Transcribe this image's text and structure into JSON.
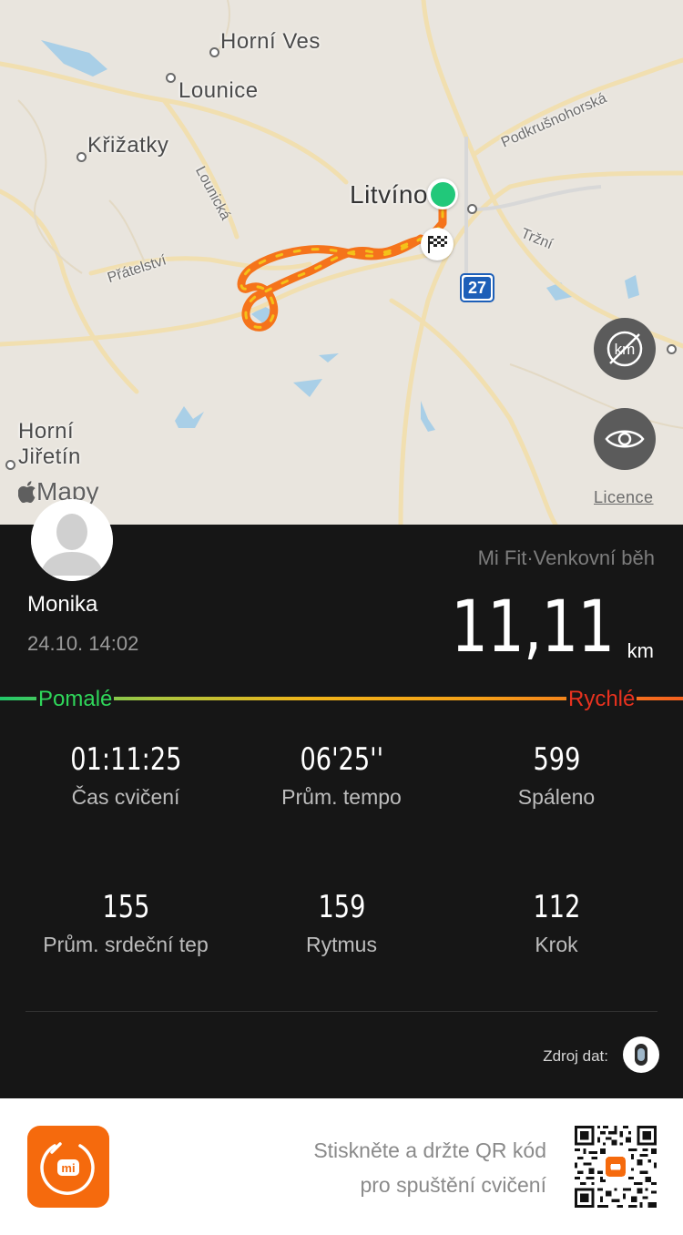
{
  "map": {
    "places": {
      "horni_ves": "Horní Ves",
      "lounice": "Lounice",
      "krizatky": "Křižatky",
      "litvinov": "Litvínov",
      "horni_jiretin": "Horní\nJiřetín"
    },
    "streets": {
      "lounicka": "Lounická",
      "pratelstvi": "Přátelství",
      "podkrusnohorska": "Podkrušnohorská",
      "trzni": "Tržní"
    },
    "road_shield": "27",
    "maps_brand": "Mapy",
    "licence": "Licence",
    "route_color": "#f5731b"
  },
  "profile": {
    "name": "Monika",
    "date": "24.10. 14:02"
  },
  "workout": {
    "source_type": "Mi Fit·Venkovní běh",
    "distance": "11,11",
    "distance_unit": "km",
    "pace_slow_label": "Pomalé",
    "pace_fast_label": "Rychlé"
  },
  "stats": [
    {
      "value": "01:11:25",
      "label": "Čas cvičení"
    },
    {
      "value": "06'25''",
      "label": "Prům. tempo"
    },
    {
      "value": "599",
      "label": "Spáleno"
    },
    {
      "value": "155",
      "label": "Prům. srdeční tep"
    },
    {
      "value": "159",
      "label": "Rytmus"
    },
    {
      "value": "112",
      "label": "Krok"
    }
  ],
  "data_source": {
    "label": "Zdroj dat:"
  },
  "footer": {
    "qr_hint_line1": "Stiskněte a držte QR kód",
    "qr_hint_line2": "pro spuštění cvičení"
  },
  "colors": {
    "accent": "#f56a0d",
    "start_marker": "#21c87a",
    "pace_slow": "#2fd65a",
    "pace_fast": "#e8321f"
  }
}
